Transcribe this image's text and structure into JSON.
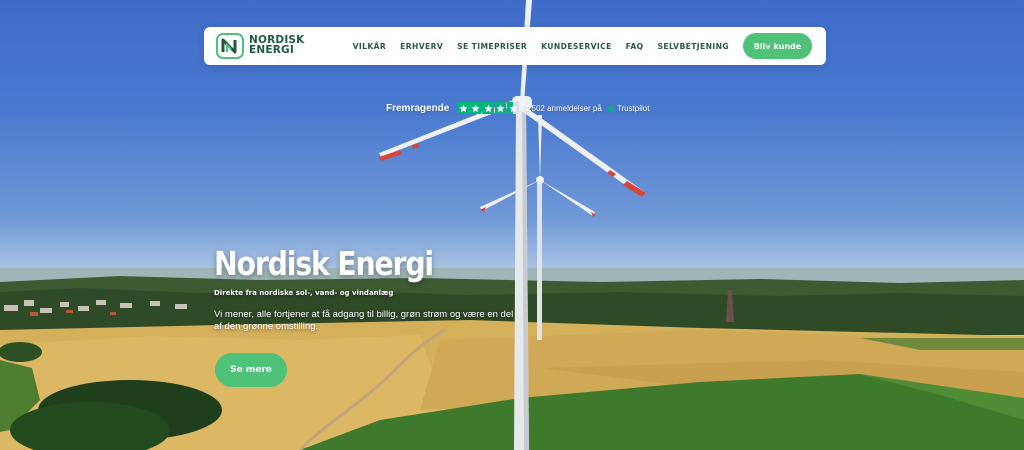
{
  "colors": {
    "brand_green": "#4fc27a",
    "brand_dark_green": "#1f5a3c",
    "trustpilot_green": "#00b67a"
  },
  "nav": {
    "logo_line1": "NORDISK",
    "logo_line2": "ENERGI",
    "logo_icon": "nordisk-energi-logo-icon",
    "links": [
      "VILKÅR",
      "ERHVERV",
      "SE TIMEPRISER",
      "KUNDESERVICE",
      "FAQ",
      "SELVBETJENING"
    ],
    "cta": "Bliv kunde"
  },
  "trust": {
    "label": "Fremragende",
    "rating_stars": 4.5,
    "count_text": "1.502 anmeldelser på",
    "provider": "Trustpilot"
  },
  "hero": {
    "title": "Nordisk Energi",
    "subtitle": "Direkte fra nordiske sol-, vand- og vindanlæg",
    "body": "Vi mener, alle fortjener at få adgang til billig, grøn strøm og være en del af den grønne omstilling.",
    "button": "Se mere"
  }
}
